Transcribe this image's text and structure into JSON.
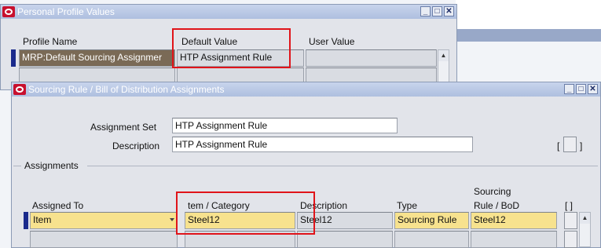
{
  "profile_window": {
    "title": "Personal Profile Values",
    "columns": {
      "name": "Profile Name",
      "default": "Default Value",
      "user": "User Value"
    },
    "row": {
      "name": "MRP:Default Sourcing Assignmer",
      "default": "HTP Assignment Rule",
      "user": ""
    }
  },
  "sourcing_window": {
    "title": "Sourcing Rule / Bill of Distribution Assignments",
    "assignment_set_label": "Assignment Set",
    "assignment_set_value": "HTP Assignment Rule",
    "description_label": "Description",
    "description_value": "HTP Assignment Rule",
    "bracket_left": "[",
    "bracket_right": "]",
    "group_label": "Assignments",
    "columns": {
      "assigned_to": "Assigned To",
      "item_category": "tem / Category",
      "description": "Description",
      "type": "Type",
      "sourcing_line1": "Sourcing",
      "sourcing_line2": "Rule / BoD",
      "bracket": "[ ]"
    },
    "row": {
      "assigned_to": "Item",
      "item_category": "Steel12",
      "description": "Steel12",
      "type": "Sourcing Rule",
      "sourcing_rule": "Steel12"
    }
  },
  "window_buttons": {
    "minimize": "_",
    "maximize": "□",
    "close": "✕"
  },
  "colors": {
    "highlight_box": "#e0141a",
    "required_field": "#f7e28e",
    "title_bar": "#aebfdf"
  }
}
